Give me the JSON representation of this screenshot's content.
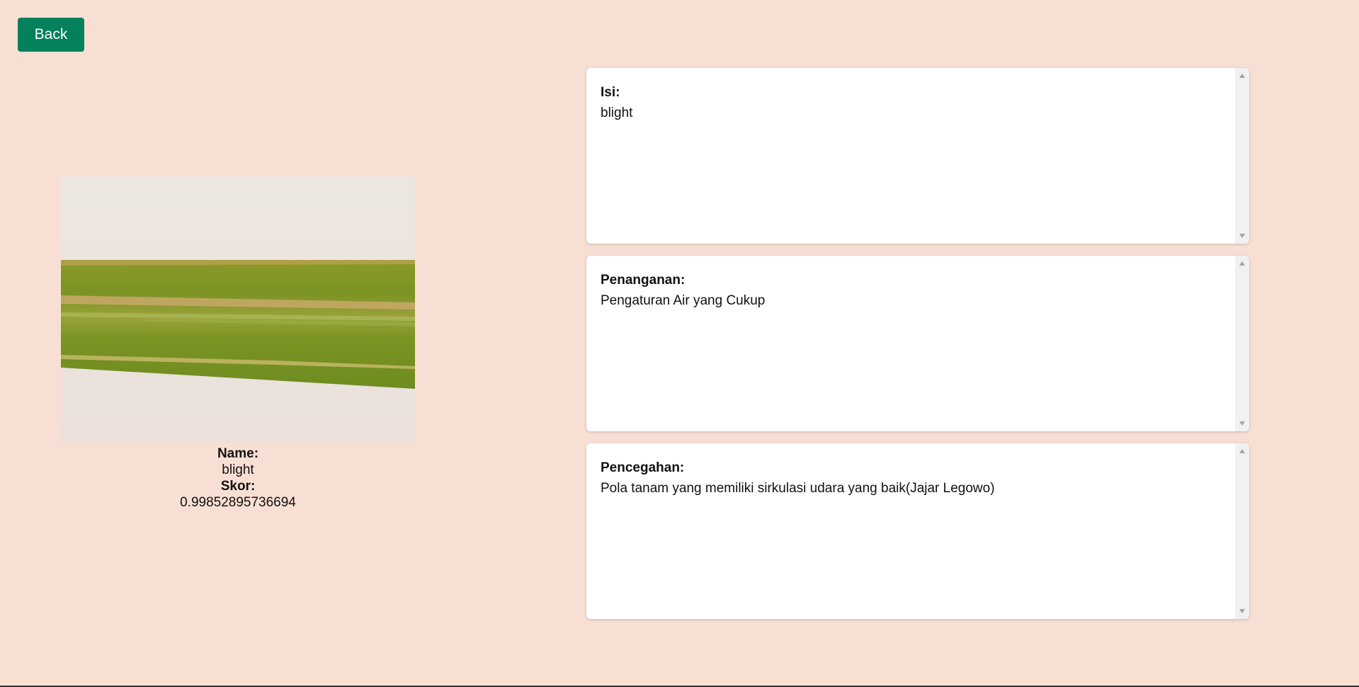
{
  "toolbar": {
    "back_label": "Back"
  },
  "result": {
    "name_label": "Name:",
    "name_value": "blight",
    "score_label": "Skor:",
    "score_value": "0.99852895736694"
  },
  "panels": [
    {
      "title": "Isi:",
      "text": "blight"
    },
    {
      "title": "Penanganan:",
      "text": "Pengaturan Air yang Cukup"
    },
    {
      "title": "Pencegahan:",
      "text": "Pola tanam yang memiliki sirkulasi udara yang baik(Jajar Legowo)"
    }
  ],
  "colors": {
    "background": "#f8dfd4",
    "button": "#03805c",
    "panel": "#ffffff"
  }
}
